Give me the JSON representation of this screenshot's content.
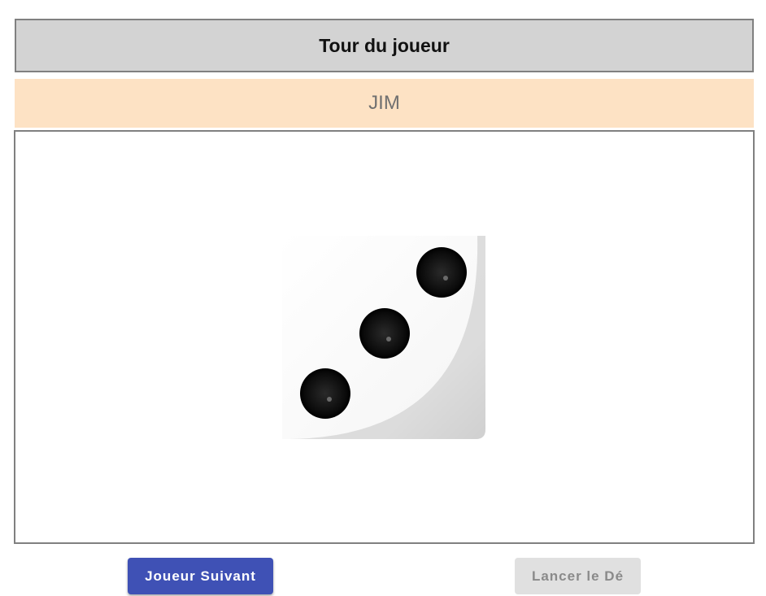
{
  "header": {
    "title": "Tour du joueur"
  },
  "player": {
    "name": "JIM"
  },
  "die": {
    "value": 3,
    "icon": "die-face-three-icon"
  },
  "actions": {
    "next_player_label": "Joueur Suivant",
    "roll_label": "Lancer le Dé"
  },
  "colors": {
    "header_bg": "#d3d3d3",
    "player_bg": "#fde2c4",
    "primary_button": "#3f51b5",
    "disabled_button": "#e0e0e0"
  }
}
